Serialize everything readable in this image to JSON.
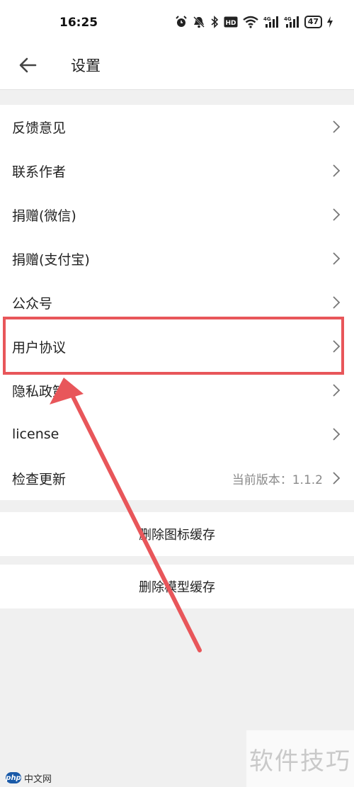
{
  "status_bar": {
    "time": "16:25",
    "battery": "47",
    "icons": [
      "alarm-icon",
      "mute-icon",
      "bluetooth-icon",
      "hd-icon",
      "wifi-icon",
      "signal-4g-icon",
      "signal-4g-icon",
      "battery-icon",
      "charging-icon"
    ]
  },
  "header": {
    "back_icon": "arrow-left-icon",
    "title": "设置"
  },
  "menu": {
    "items": [
      {
        "label": "反馈意见"
      },
      {
        "label": "联系作者"
      },
      {
        "label": "捐赠(微信)"
      },
      {
        "label": "捐赠(支付宝)"
      },
      {
        "label": "公众号"
      },
      {
        "label": "用户协议"
      },
      {
        "label": "隐私政策"
      },
      {
        "label": "license"
      },
      {
        "label": "检查更新",
        "value": "当前版本：1.1.2"
      }
    ]
  },
  "actions": {
    "clear_icon_cache": "删除图标缓存",
    "clear_model_cache": "删除模型缓存"
  },
  "annotation": {
    "color": "#e8565a",
    "highlighted_item": "用户协议"
  },
  "watermark": {
    "right_text": "软件技巧",
    "left_logo": "php",
    "left_text": "中文网"
  }
}
